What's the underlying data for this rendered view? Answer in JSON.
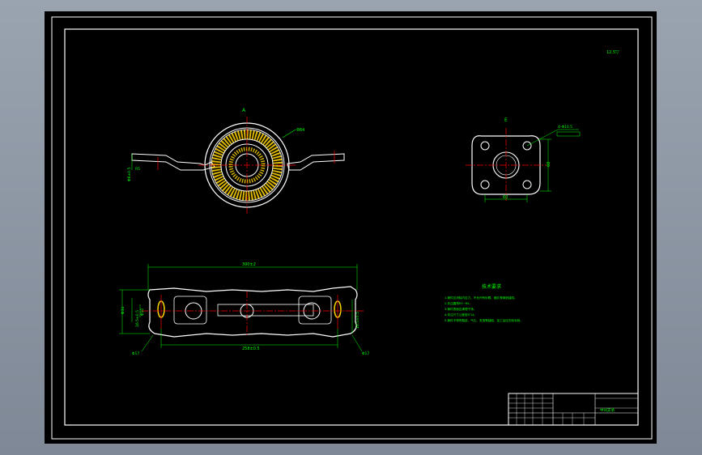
{
  "views": {
    "front_label": "A",
    "side_label": "E"
  },
  "dims": {
    "overall_length": "390±2",
    "hole_center": "258±0.5",
    "flange_w": "60",
    "flange_h": "60",
    "hole_tol": "4-Φ10.5",
    "bore": "Φ84",
    "left_h1": "Φ34",
    "left_h2": "16.5±0.5",
    "left_h3": "Φ10",
    "right_h": "16.5±0.5",
    "left_r": "Φ17",
    "right_r": "Φ17",
    "side_small": "R5",
    "thick": "Φ8±0.5"
  },
  "roughness": {
    "value": "12.5",
    "symbol": "▽"
  },
  "tech_notes": {
    "heading": "技术要求",
    "lines": [
      "1.铸件应消除内应力，不允许有砂眼、缩孔等铸造缺陷。",
      "2.未注圆角R3~R5。",
      "3.铸件表面应清理干净。",
      "4.未注尺寸公差按IT14。",
      "5.铸件不得有裂纹、气孔、夹渣等缺陷，加工后应去除毛刺。"
    ]
  },
  "title_block": {
    "part_name": "中间支承",
    "sheet_cells": [
      "",
      "",
      "",
      ""
    ]
  },
  "colors": {
    "outline": "#ffffff",
    "frame": "#ffffff",
    "center": "#ff0000",
    "dimension": "#00ff00",
    "hatch": "#ffd400",
    "leader": "#00ffff"
  }
}
